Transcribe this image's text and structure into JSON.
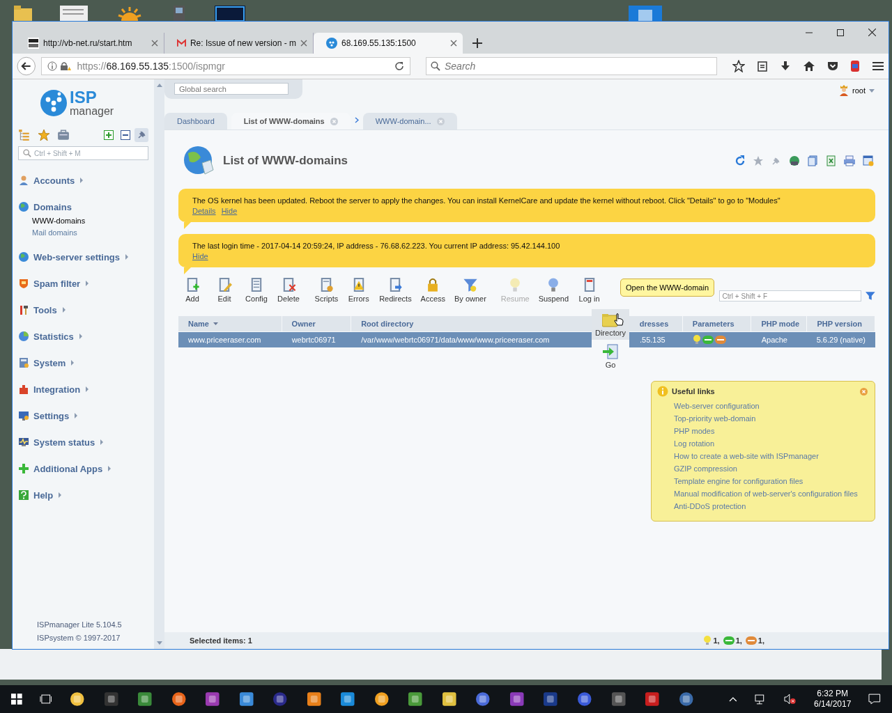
{
  "browser": {
    "tabs": [
      {
        "title": "http://vb-net.ru/start.htm",
        "selected": false
      },
      {
        "title": "Re: Issue of new version - m",
        "selected": false
      },
      {
        "title": "68.169.55.135:1500",
        "selected": true
      }
    ],
    "url": {
      "scheme": "https://",
      "host": "68.169.55.135",
      "path": ":1500/ispmgr"
    },
    "search": {
      "placeholder": "Search"
    }
  },
  "app": {
    "logo": {
      "title": "ISP",
      "subtitle": "manager"
    },
    "global_search": {
      "placeholder": "Global search"
    },
    "user": "root",
    "sidebar": {
      "search": {
        "placeholder": "Ctrl + Shift + M"
      },
      "items": [
        {
          "label": "Accounts",
          "expanded": false
        },
        {
          "label": "Domains",
          "expanded": true,
          "children": [
            {
              "label": "WWW-domains",
              "selected": true
            },
            {
              "label": "Mail domains",
              "selected": false
            }
          ]
        },
        {
          "label": "Web-server settings",
          "expanded": false
        },
        {
          "label": "Spam filter",
          "expanded": false
        },
        {
          "label": "Tools",
          "expanded": false
        },
        {
          "label": "Statistics",
          "expanded": false
        },
        {
          "label": "System",
          "expanded": false
        },
        {
          "label": "Integration",
          "expanded": false
        },
        {
          "label": "Settings",
          "expanded": false
        },
        {
          "label": "System status",
          "expanded": false
        },
        {
          "label": "Additional Apps",
          "expanded": false
        },
        {
          "label": "Help",
          "expanded": false
        }
      ],
      "footer": [
        "ISPmanager Lite 5.104.5",
        "ISPsystem © 1997-2017"
      ]
    },
    "tabs": [
      {
        "label": "Dashboard",
        "selected": false,
        "closable": false
      },
      {
        "label": "List of WWW-domains",
        "selected": true,
        "closable": true
      },
      {
        "label": "WWW-domain...",
        "selected": false,
        "closable": true
      }
    ],
    "page_title": "List of WWW-domains",
    "notices": [
      {
        "text": "The OS kernel has been updated. Reboot the server to apply the changes. You can install KernelCare and update the kernel without reboot. Click \"Details\" to go to \"Modules\"",
        "links": [
          "Details",
          "Hide"
        ]
      },
      {
        "text": "The last login time - 2017-04-14 20:59:24, IP address - 76.68.62.223. You current IP address: 95.42.144.100",
        "links": [
          "Hide"
        ]
      }
    ],
    "toolbar": [
      {
        "label": "Add",
        "disabled": false
      },
      {
        "label": "Edit",
        "disabled": false
      },
      {
        "label": "Config",
        "disabled": false
      },
      {
        "label": "Delete",
        "disabled": false
      },
      {
        "label": "Scripts",
        "disabled": false
      },
      {
        "label": "Errors",
        "disabled": false
      },
      {
        "label": "Redirects",
        "disabled": false
      },
      {
        "label": "Access",
        "disabled": false
      },
      {
        "label": "By owner",
        "disabled": false
      },
      {
        "label": "Resume",
        "disabled": true
      },
      {
        "label": "Suspend",
        "disabled": false
      },
      {
        "label": "Log in",
        "disabled": false
      }
    ],
    "filter": {
      "placeholder": "Ctrl + Shift + F"
    },
    "tooltip": "Open the WWW-domain",
    "context_menu": [
      {
        "label": "Directory",
        "selected": true
      },
      {
        "label": "Go",
        "selected": false
      }
    ],
    "table": {
      "columns": [
        {
          "label": "Name",
          "sorted": true
        },
        {
          "label": "Owner",
          "sorted": false
        },
        {
          "label": "Root directory",
          "sorted": false
        },
        {
          "label": "dresses",
          "sorted": false
        },
        {
          "label": "Parameters",
          "sorted": false
        },
        {
          "label": "PHP mode",
          "sorted": false
        },
        {
          "label": "PHP version",
          "sorted": false
        }
      ],
      "rows": [
        {
          "selected": true,
          "cells": [
            "www.priceeraser.com",
            "webrtc06971",
            "/var/www/webrtc06971/data/www/www.priceeraser.com",
            ".55.135",
            "",
            "Apache",
            "5.6.29 (native)"
          ]
        }
      ]
    },
    "useful_links": {
      "title": "Useful links",
      "links": [
        "Web-server configuration",
        "Top-priority web-domain",
        "PHP modes",
        "Log rotation",
        "How to create a web-site with ISPmanager",
        "GZIP compression",
        "Template engine for configuration files",
        "Manual modification of web-server's configuration files",
        "Anti-DDoS protection"
      ]
    },
    "status_bar": {
      "label": "Selected items: 1",
      "counts": [
        "1,",
        "1,",
        "1,"
      ]
    }
  },
  "taskbar": {
    "time": "6:32 PM",
    "date": "6/14/2017"
  }
}
